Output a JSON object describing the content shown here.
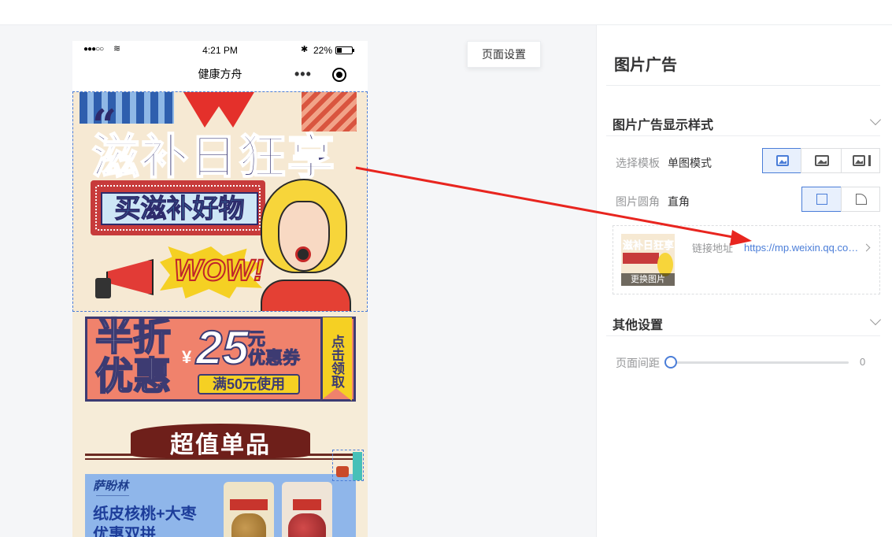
{
  "status_bar": {
    "signal": "●●●○○",
    "time": "4:21 PM",
    "battery": "22%"
  },
  "phone": {
    "nav_title": "健康方舟",
    "menu_dots": "•••",
    "banner1": {
      "title": "滋补日狂享",
      "subtitle": "买滋补好物",
      "wow": "WOW!"
    },
    "coupon": {
      "half": "半折",
      "half2": "优惠",
      "yen": "¥",
      "amount": "25",
      "unit": "元",
      "type": "优惠券",
      "condition": "满50元使用",
      "claim": "点击领取"
    },
    "section_title": "超值单品",
    "product": {
      "brand": "萨盼林",
      "name_line1": "纸皮核桃+大枣",
      "name_line2": "优惠双拼"
    }
  },
  "canvas": {
    "page_settings_button": "页面设置"
  },
  "panel": {
    "title": "图片广告",
    "display_section": {
      "header": "图片广告显示样式",
      "template_label": "选择模板",
      "template_value": "单图模式",
      "corner_label": "图片圆角",
      "corner_value": "直角"
    },
    "image_card": {
      "thumb_title": "滋补日狂享",
      "replace_label": "更换图片",
      "link_label": "链接地址",
      "link_value": "https://mp.weixin.qq.com/s/..."
    },
    "other_section": {
      "header": "其他设置",
      "spacing_label": "页面间距",
      "spacing_value": "0"
    }
  },
  "colors": {
    "accent": "#4a7dd8",
    "arrow": "#e8251f"
  }
}
